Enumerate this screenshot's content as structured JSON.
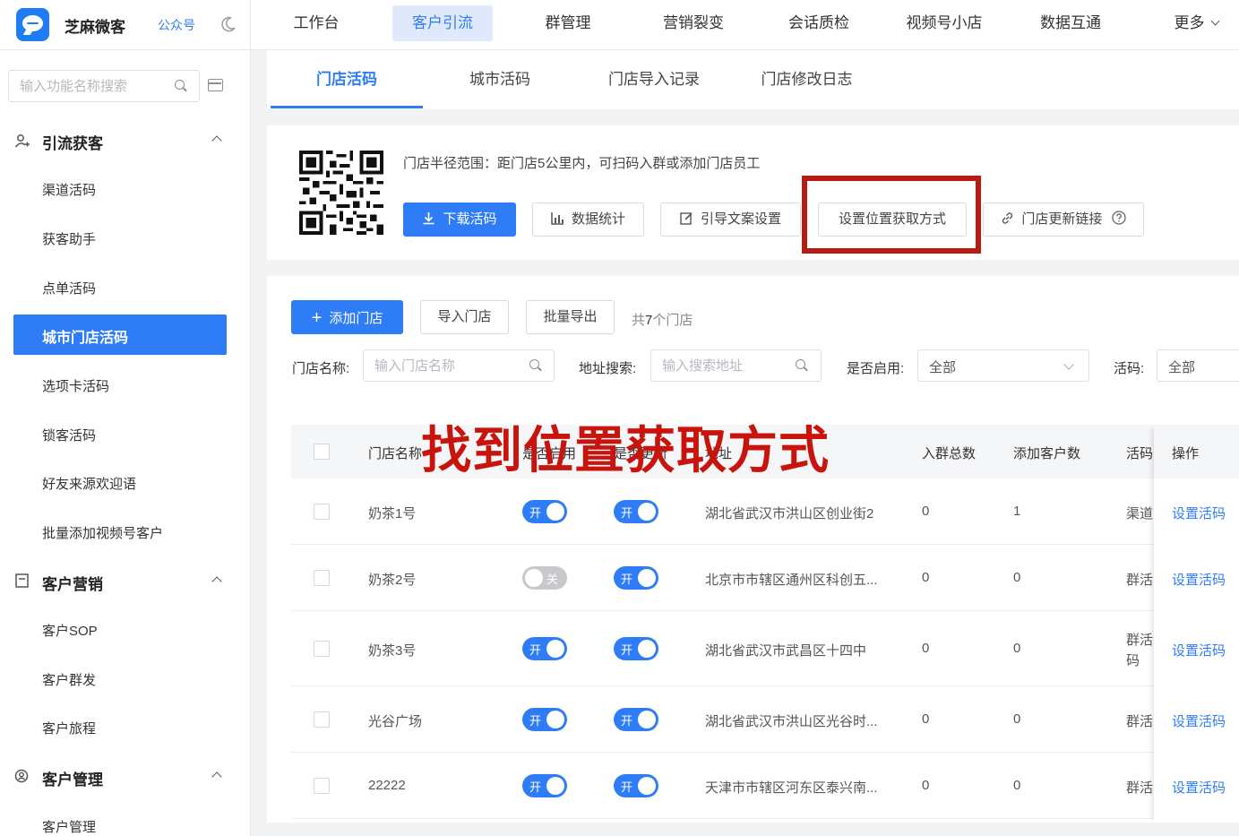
{
  "brand": {
    "name": "芝麻微客",
    "tag": "公众号"
  },
  "nav": {
    "items": [
      "工作台",
      "客户引流",
      "群管理",
      "营销裂变",
      "会话质检",
      "视频号小店",
      "数据互通"
    ],
    "more": "更多",
    "active_index": 1
  },
  "sidebar": {
    "search_placeholder": "输入功能名称搜索",
    "groups": [
      {
        "title": "引流获客",
        "items": [
          "渠道活码",
          "获客助手",
          "点单活码",
          "城市门店活码",
          "选项卡活码",
          "锁客活码",
          "好友来源欢迎语",
          "批量添加视频号客户"
        ]
      },
      {
        "title": "客户营销",
        "items": [
          "客户SOP",
          "客户群发",
          "客户旅程"
        ]
      },
      {
        "title": "客户管理",
        "items": [
          "客户管理"
        ]
      }
    ],
    "active_item": "城市门店活码"
  },
  "tabs": {
    "items": [
      "门店活码",
      "城市活码",
      "门店导入记录",
      "门店修改日志"
    ],
    "active_index": 0
  },
  "qr_card": {
    "description": "门店半径范围：距门店5公里内，可扫码入群或添加门店员工",
    "buttons": {
      "download": "下载活码",
      "stats": "数据统计",
      "guide": "引导文案设置",
      "location": "设置位置获取方式",
      "update_link": "门店更新链接"
    }
  },
  "store_list": {
    "add_button": "添加门店",
    "import_button": "导入门店",
    "export_button": "批量导出",
    "count_prefix": "共",
    "count": "7",
    "count_suffix": "个门店",
    "filters": {
      "name_label": "门店名称:",
      "name_placeholder": "输入门店名称",
      "address_label": "地址搜索:",
      "address_placeholder": "输入搜索地址",
      "enabled_label": "是否启用:",
      "enabled_value": "全部",
      "code_label": "活码:",
      "code_value": "全部"
    },
    "columns": [
      "门店名称",
      "是否启用",
      "是否更新",
      "地址",
      "入群总数",
      "添加客户数",
      "活码",
      "操作"
    ],
    "rows": [
      {
        "name": "奶茶1号",
        "enabled": true,
        "enabled_text": "开",
        "update": true,
        "update_text": "开",
        "address": "湖北省武汉市洪山区创业街2",
        "groups": "0",
        "customers": "1",
        "code": "渠道",
        "action": "设置活码"
      },
      {
        "name": "奶茶2号",
        "enabled": false,
        "enabled_text": "关",
        "update": true,
        "update_text": "开",
        "address": "北京市市辖区通州区科创五...",
        "groups": "0",
        "customers": "0",
        "code": "群活",
        "action": "设置活码"
      },
      {
        "name": "奶茶3号",
        "enabled": true,
        "enabled_text": "开",
        "update": true,
        "update_text": "开",
        "address": "湖北省武汉市武昌区十四中",
        "groups": "0",
        "customers": "0",
        "code": "群活码",
        "action": "设置活码"
      },
      {
        "name": "光谷广场",
        "enabled": true,
        "enabled_text": "开",
        "update": true,
        "update_text": "开",
        "address": "湖北省武汉市洪山区光谷时...",
        "groups": "0",
        "customers": "0",
        "code": "群活",
        "action": "设置活码"
      },
      {
        "name": "22222",
        "enabled": true,
        "enabled_text": "开",
        "update": true,
        "update_text": "开",
        "address": "天津市市辖区河东区泰兴南...",
        "groups": "0",
        "customers": "0",
        "code": "群活",
        "action": "设置活码"
      }
    ]
  },
  "annotation": {
    "text": "找到位置获取方式"
  },
  "colors": {
    "primary": "#2f7df6",
    "annotation_red": "#c9140e",
    "highlight_border": "#b71c14"
  }
}
